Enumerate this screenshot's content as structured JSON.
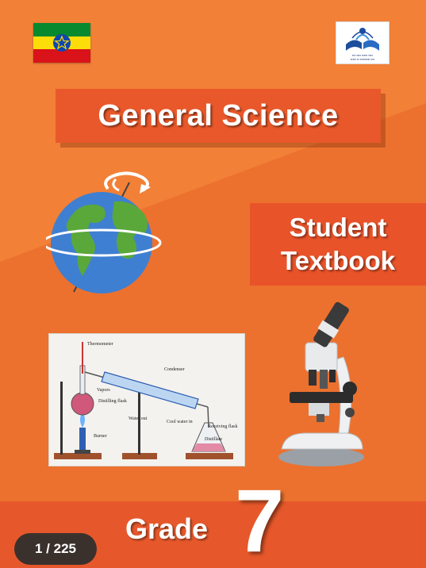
{
  "cover": {
    "title": "General Science",
    "subtitle_line1": "Student",
    "subtitle_line2": "Textbook",
    "grade_label": "Grade",
    "grade_number": "7"
  },
  "viewer": {
    "page_indicator": "1 / 225"
  },
  "diagram_labels": {
    "thermometer": "Thermometer",
    "condenser": "Condenser",
    "vapors": "Vapors",
    "distilling_flask": "Distilling flask",
    "water_out": "Water out",
    "cool_water_in": "Cool water in",
    "receiving_flask": "Receiving flask",
    "burner": "Burner",
    "distillate": "Distillate"
  },
  "colors": {
    "background": "#f07a32",
    "banner": "#e9582a",
    "flag_green": "#078930",
    "flag_yellow": "#fcdd09",
    "flag_red": "#da121a",
    "emblem_blue": "#0f47af"
  },
  "icons": {
    "flag": "ethiopian-flag-icon",
    "logo": "ministry-of-education-logo",
    "globe": "rotating-globe-icon",
    "microscope": "microscope-icon"
  }
}
